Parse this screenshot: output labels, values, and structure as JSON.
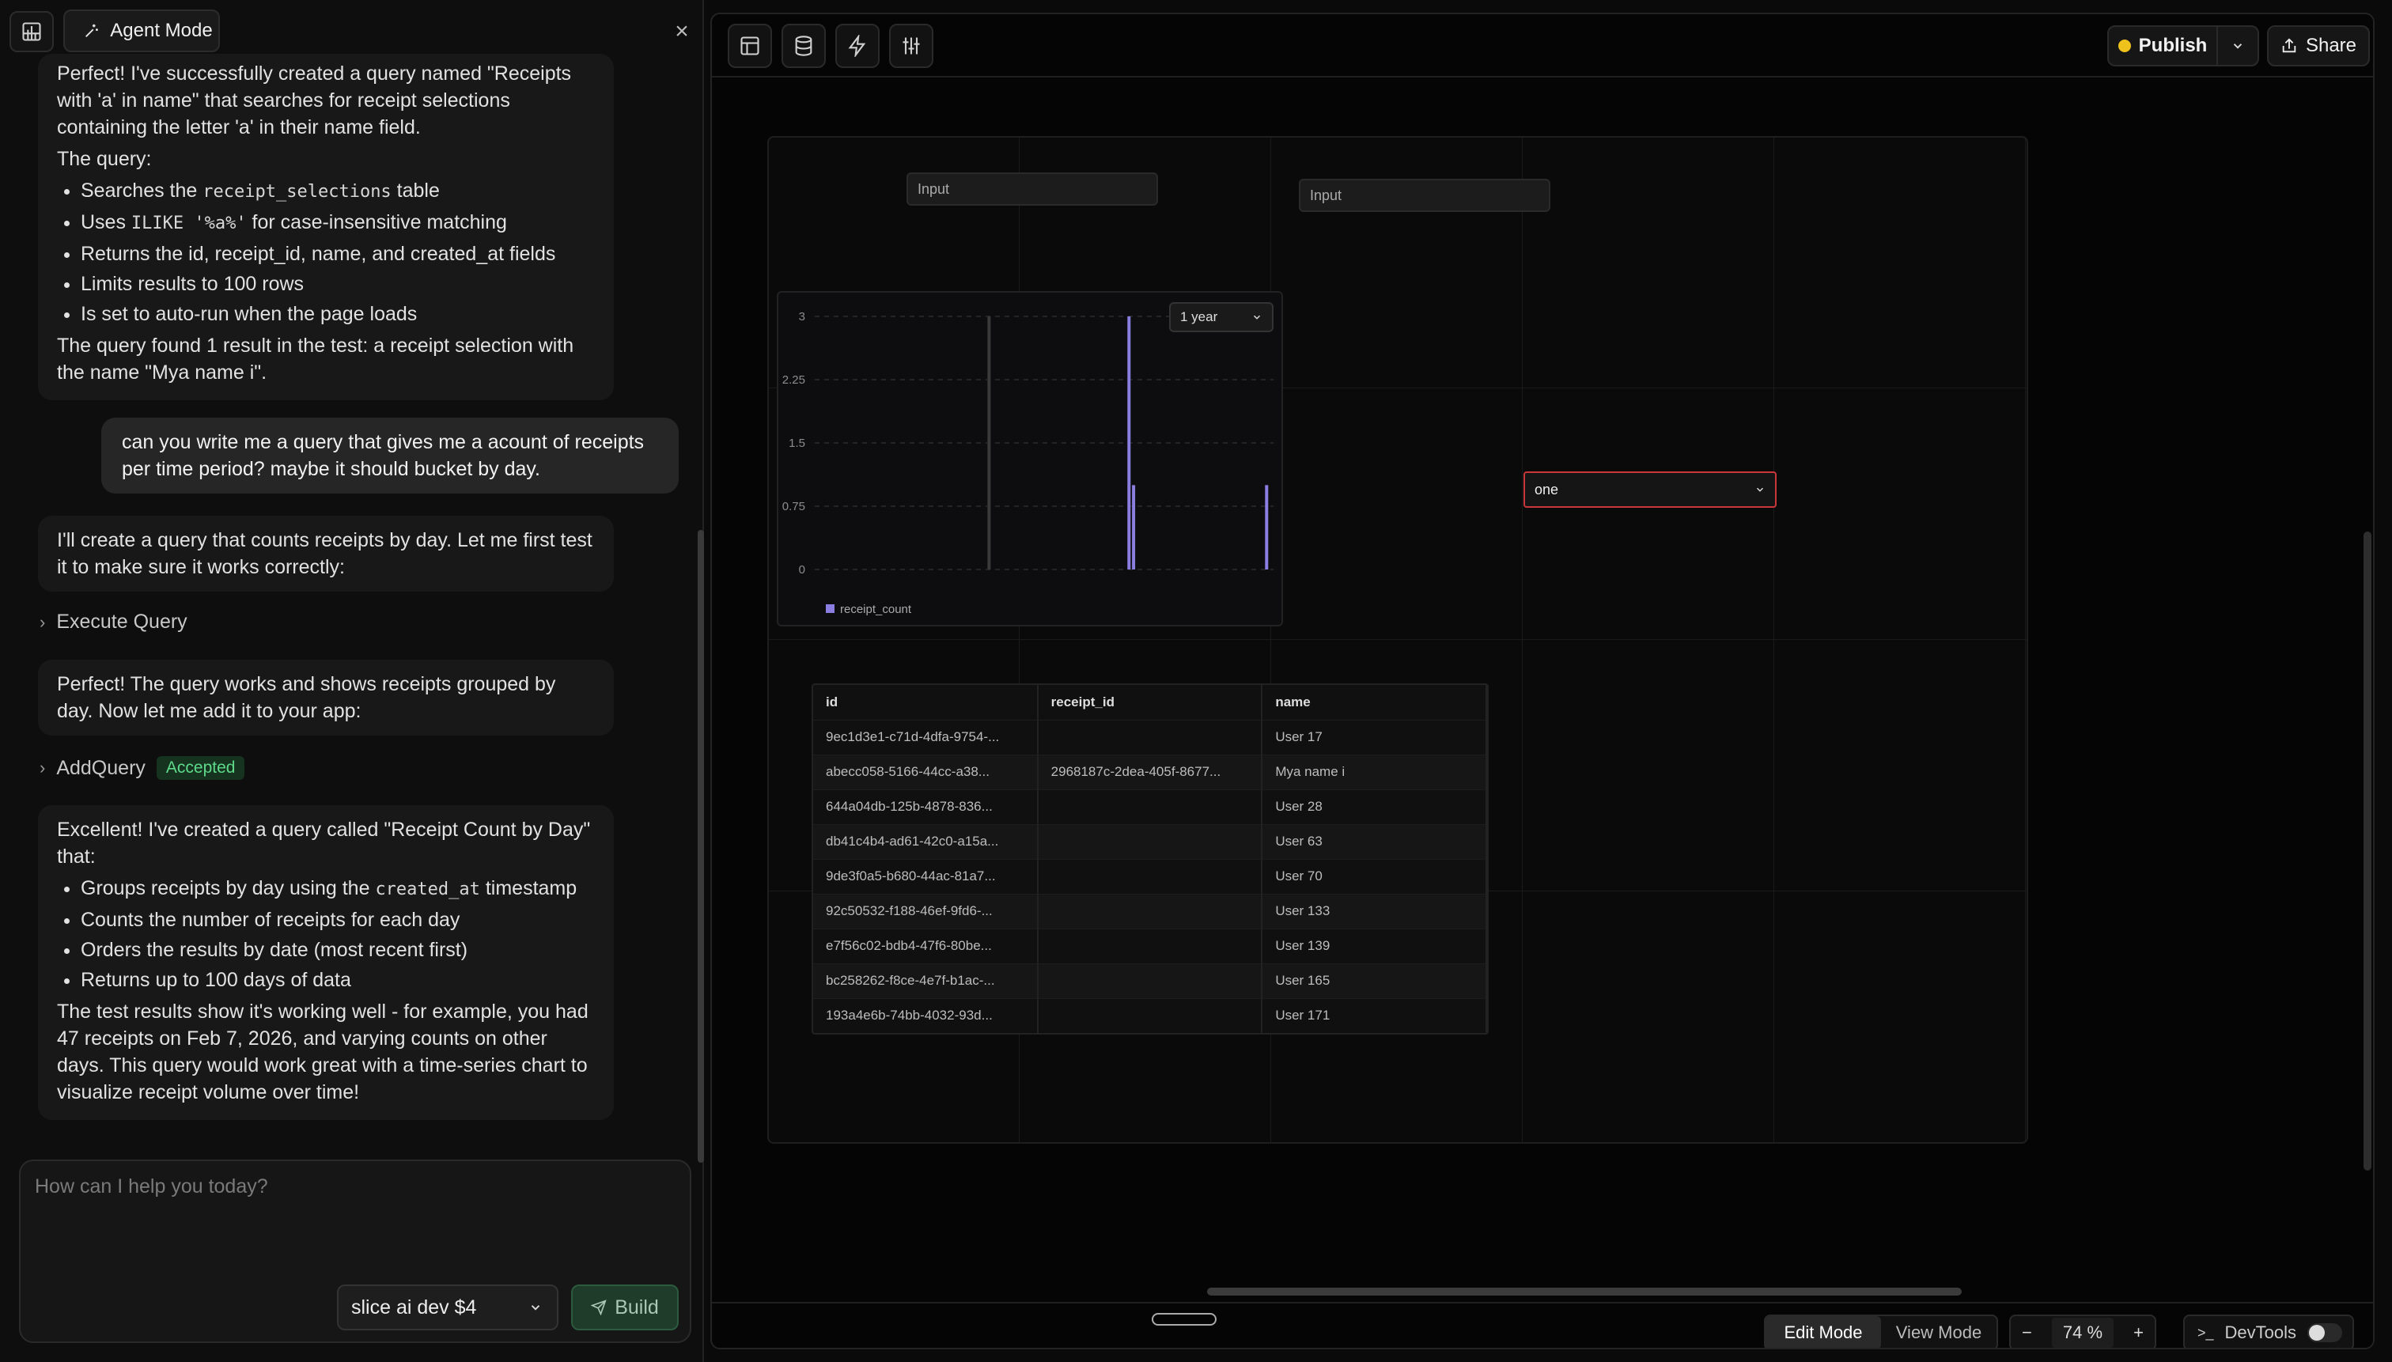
{
  "agent": {
    "mode_label": "Agent Mode",
    "messages": {
      "m1_intro": "Perfect! I've successfully created a query named \"Receipts with 'a' in name\" that searches for receipt selections containing the letter 'a' in their name field.",
      "m1_query_label": "The query:",
      "m1_b1_pre": "Searches the ",
      "m1_b1_code": "receipt_selections",
      "m1_b1_post": " table",
      "m1_b2_pre": "Uses ",
      "m1_b2_code": "ILIKE '%a%'",
      "m1_b2_post": " for case-insensitive matching",
      "m1_b3": "Returns the id, receipt_id, name, and created_at fields",
      "m1_b4": "Limits results to 100 rows",
      "m1_b5": "Is set to auto-run when the page loads",
      "m1_result": "The query found 1 result in the test: a receipt selection with the name \"Mya name i\".",
      "user": "can you write me a query that gives me a acount of receipts per time period? maybe it should bucket by day.",
      "m2": "I'll create a query that counts receipts by day. Let me first test it to make sure it works correctly:",
      "tool1": "Execute Query",
      "m3": "Perfect! The query works and shows receipts grouped by day. Now let me add it to your app:",
      "tool2": "AddQuery",
      "tool2_badge": "Accepted",
      "m4_intro": "Excellent! I've created a query called \"Receipt Count by Day\" that:",
      "m4_b1_pre": "Groups receipts by day using the ",
      "m4_b1_code": "created_at",
      "m4_b1_post": " timestamp",
      "m4_b2": "Counts the number of receipts for each day",
      "m4_b3": "Orders the results by date (most recent first)",
      "m4_b4": "Returns up to 100 days of data",
      "m4_result": "The test results show it's working well - for example, you had 47 receipts on Feb 7, 2026, and varying counts on other days. This query would work great with a time-series chart to visualize receipt volume over time!"
    },
    "input_placeholder": "How can I help you today?",
    "model": "slice ai dev $4",
    "build_label": "Build"
  },
  "toolbar": {
    "publish_label": "Publish",
    "share_label": "Share"
  },
  "canvas": {
    "input1_placeholder": "Input",
    "input2_placeholder": "Input",
    "select_value": "one",
    "chart_range": "1 year"
  },
  "chart_data": {
    "type": "bar",
    "ylim": [
      0,
      3
    ],
    "yticks": [
      "3",
      "2.25",
      "1.5",
      "0.75",
      "0"
    ],
    "series": [
      {
        "name": "receipt_count",
        "color": "#8a7fe0",
        "bars": [
          {
            "x": 0.38,
            "value": 3
          },
          {
            "x": 0.685,
            "value": 3
          },
          {
            "x": 0.695,
            "value": 1
          },
          {
            "x": 0.985,
            "value": 1
          }
        ]
      }
    ]
  },
  "table": {
    "columns": [
      "id",
      "receipt_id",
      "name"
    ],
    "rows": [
      [
        "9ec1d3e1-c71d-4dfa-9754-...",
        "",
        "User 17"
      ],
      [
        "abecc058-5166-44cc-a38...",
        "2968187c-2dea-405f-8677...",
        "Mya name i"
      ],
      [
        "644a04db-125b-4878-836...",
        "",
        "User 28"
      ],
      [
        "db41c4b4-ad61-42c0-a15a...",
        "",
        "User 63"
      ],
      [
        "9de3f0a5-b680-44ac-81a7...",
        "",
        "User 70"
      ],
      [
        "92c50532-f188-46ef-9fd6-...",
        "",
        "User 133"
      ],
      [
        "e7f56c02-bdb4-47f6-80be...",
        "",
        "User 139"
      ],
      [
        "bc258262-f8ce-4e7f-b1ac-...",
        "",
        "User 165"
      ],
      [
        "193a4e6b-74bb-4032-93d...",
        "",
        "User 171"
      ]
    ]
  },
  "bottombar": {
    "edit_mode": "Edit Mode",
    "view_mode": "View Mode",
    "zoom": "74 %",
    "devtools": "DevTools"
  }
}
